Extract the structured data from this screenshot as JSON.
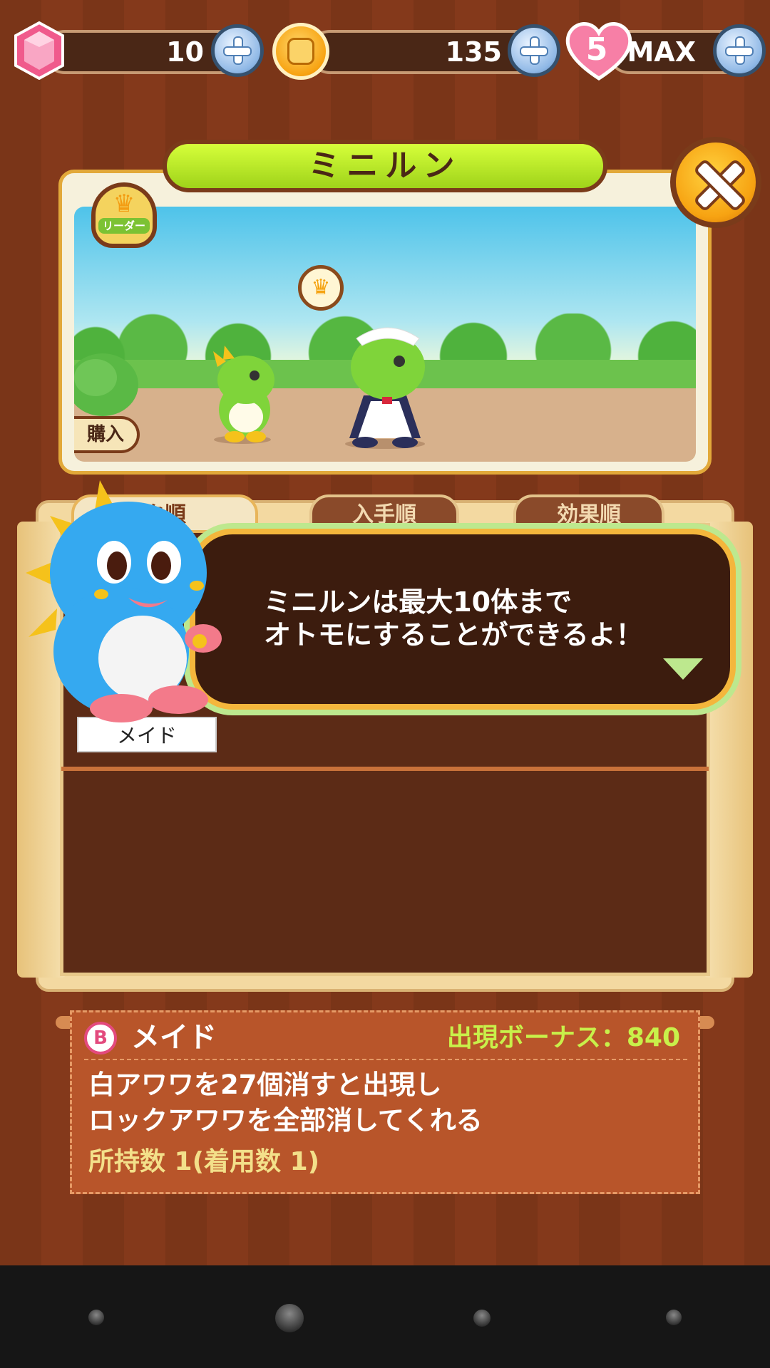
{
  "currencies": {
    "gems": "10",
    "coins": "135",
    "hearts_count": "5",
    "hearts_state": "MAX"
  },
  "popup": {
    "title": "ミニルン",
    "leader_label": "リーダー",
    "buy_label": "購入"
  },
  "tabs": [
    {
      "label": "ク順"
    },
    {
      "label": "入手順"
    },
    {
      "label": "効果順"
    }
  ],
  "list": {
    "selected_item_label": "メイド"
  },
  "dialog": {
    "line1": "ミニルンは最大10体まで",
    "line2": "オトモにすることができるよ！"
  },
  "info": {
    "rank_badge": "B",
    "name": "メイド",
    "bonus": "出現ボーナス：840",
    "desc_line1": "白アワワを27個消すと出現し",
    "desc_line2": "ロックアワワを全部消してくれる",
    "owned": "所持数 1(着用数 1)"
  },
  "colors": {
    "title_green": "#b8e62a",
    "close_orange": "#f7a312",
    "bonus_green": "#c8f04a",
    "info_bg": "#b8552a"
  },
  "icons": [
    "gem-icon",
    "coin-medal-icon",
    "heart-icon",
    "plus-icon",
    "close-icon",
    "crown-icon"
  ]
}
